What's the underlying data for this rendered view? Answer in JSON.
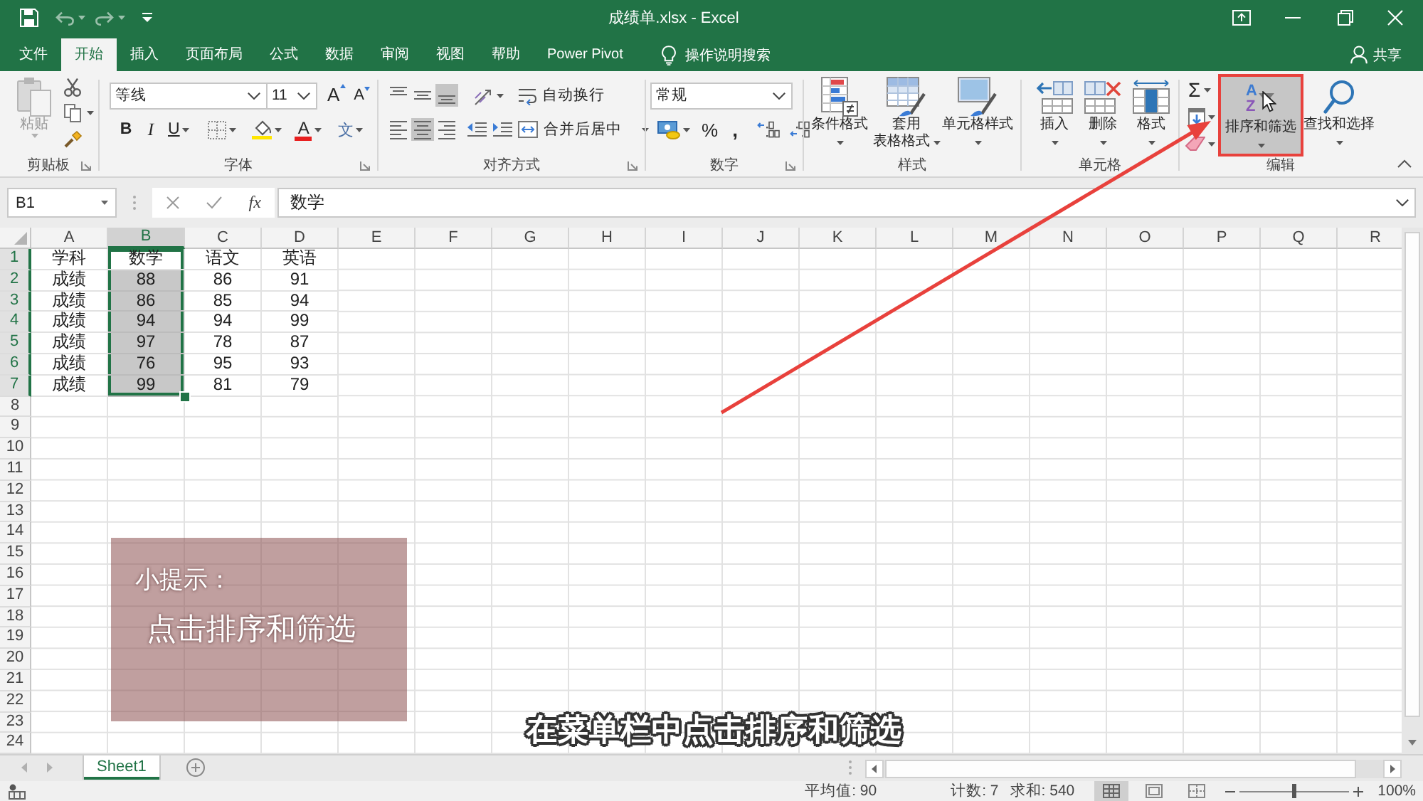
{
  "title_bar": {
    "title": "成绩单.xlsx - Excel"
  },
  "menu_tabs": [
    {
      "label": "文件",
      "selected": false
    },
    {
      "label": "开始",
      "selected": true
    },
    {
      "label": "插入",
      "selected": false
    },
    {
      "label": "页面布局",
      "selected": false
    },
    {
      "label": "公式",
      "selected": false
    },
    {
      "label": "数据",
      "selected": false
    },
    {
      "label": "审阅",
      "selected": false
    },
    {
      "label": "视图",
      "selected": false
    },
    {
      "label": "帮助",
      "selected": false
    },
    {
      "label": "Power Pivot",
      "selected": false
    }
  ],
  "tell_me": {
    "label": "操作说明搜索"
  },
  "share": {
    "label": "共享"
  },
  "ribbon": {
    "groups": [
      {
        "kind": "clipboard",
        "label": "剪贴板",
        "launcher": true,
        "paste": {
          "label": "粘贴",
          "disabled": true
        }
      },
      {
        "kind": "font",
        "label": "字体",
        "launcher": true,
        "font_name": "等线",
        "font_size": "11",
        "grow": "A",
        "shrink": "A",
        "bold": "B",
        "italic": "I",
        "underline": "U",
        "font_color": "A",
        "phonetic": "文"
      },
      {
        "kind": "alignment",
        "label": "对齐方式",
        "launcher": true,
        "vertical": [
          {
            "kind": "top",
            "selected": false
          },
          {
            "kind": "middle",
            "selected": false
          },
          {
            "kind": "bottom",
            "selected": true
          }
        ],
        "horizontal": [
          {
            "kind": "left",
            "selected": false
          },
          {
            "kind": "center",
            "selected": true
          },
          {
            "kind": "right",
            "selected": false
          }
        ],
        "wrap": "自动换行",
        "merge": "合并后居中"
      },
      {
        "kind": "number",
        "label": "数字",
        "launcher": true,
        "format": "常规",
        "percent": "%",
        "comma": ","
      },
      {
        "kind": "styles",
        "label": "样式",
        "launcher": false,
        "buttons": [
          {
            "kind": "conditional",
            "lines": [
              "条件格式"
            ]
          },
          {
            "kind": "table",
            "lines": [
              "套用",
              "表格格式"
            ]
          },
          {
            "kind": "cell_style",
            "lines": [
              "单元格样式"
            ]
          }
        ]
      },
      {
        "kind": "cells",
        "label": "单元格",
        "launcher": false,
        "buttons": [
          {
            "kind": "insert",
            "label": "插入"
          },
          {
            "kind": "delete",
            "label": "删除"
          },
          {
            "kind": "format",
            "label": "格式"
          }
        ]
      },
      {
        "kind": "editing",
        "label": "编辑",
        "launcher": false,
        "autosum": "Σ",
        "buttons": [
          {
            "kind": "sort",
            "label": "排序和筛选",
            "hover": true,
            "framed": true,
            "icon_letters": [
              "A",
              "Z"
            ]
          },
          {
            "kind": "find",
            "label": "查找和选择",
            "hover": false,
            "framed": false
          }
        ]
      }
    ]
  },
  "formula_bar": {
    "name_box": "B1",
    "function_button": "fx",
    "formula": "数学"
  },
  "sheet": {
    "columns": [
      {
        "label": "A",
        "selected": false
      },
      {
        "label": "B",
        "selected": true
      },
      {
        "label": "C",
        "selected": false
      },
      {
        "label": "D",
        "selected": false
      },
      {
        "label": "E",
        "selected": false
      },
      {
        "label": "F",
        "selected": false
      },
      {
        "label": "G",
        "selected": false
      },
      {
        "label": "H",
        "selected": false
      },
      {
        "label": "I",
        "selected": false
      },
      {
        "label": "J",
        "selected": false
      },
      {
        "label": "K",
        "selected": false
      },
      {
        "label": "L",
        "selected": false
      },
      {
        "label": "M",
        "selected": false
      },
      {
        "label": "N",
        "selected": false
      },
      {
        "label": "O",
        "selected": false
      },
      {
        "label": "P",
        "selected": false
      },
      {
        "label": "Q",
        "selected": false
      },
      {
        "label": "R",
        "selected": false
      }
    ],
    "rows": [
      {
        "label": "1",
        "selected": true,
        "cells": [
          {
            "text": "学科",
            "selected": false,
            "active": false
          },
          {
            "text": "数学",
            "selected": true,
            "active": true
          },
          {
            "text": "语文",
            "selected": false,
            "active": false
          },
          {
            "text": "英语",
            "selected": false,
            "active": false
          }
        ]
      },
      {
        "label": "2",
        "selected": true,
        "cells": [
          {
            "text": "成绩",
            "selected": false,
            "active": false
          },
          {
            "text": "88",
            "selected": true,
            "active": false
          },
          {
            "text": "86",
            "selected": false,
            "active": false
          },
          {
            "text": "91",
            "selected": false,
            "active": false
          }
        ]
      },
      {
        "label": "3",
        "selected": true,
        "cells": [
          {
            "text": "成绩",
            "selected": false,
            "active": false
          },
          {
            "text": "86",
            "selected": true,
            "active": false
          },
          {
            "text": "85",
            "selected": false,
            "active": false
          },
          {
            "text": "94",
            "selected": false,
            "active": false
          }
        ]
      },
      {
        "label": "4",
        "selected": true,
        "cells": [
          {
            "text": "成绩",
            "selected": false,
            "active": false
          },
          {
            "text": "94",
            "selected": true,
            "active": false
          },
          {
            "text": "94",
            "selected": false,
            "active": false
          },
          {
            "text": "99",
            "selected": false,
            "active": false
          }
        ]
      },
      {
        "label": "5",
        "selected": true,
        "cells": [
          {
            "text": "成绩",
            "selected": false,
            "active": false
          },
          {
            "text": "97",
            "selected": true,
            "active": false
          },
          {
            "text": "78",
            "selected": false,
            "active": false
          },
          {
            "text": "87",
            "selected": false,
            "active": false
          }
        ]
      },
      {
        "label": "6",
        "selected": true,
        "cells": [
          {
            "text": "成绩",
            "selected": false,
            "active": false
          },
          {
            "text": "76",
            "selected": true,
            "active": false
          },
          {
            "text": "95",
            "selected": false,
            "active": false
          },
          {
            "text": "93",
            "selected": false,
            "active": false
          }
        ]
      },
      {
        "label": "7",
        "selected": true,
        "cells": [
          {
            "text": "成绩",
            "selected": false,
            "active": false
          },
          {
            "text": "99",
            "selected": true,
            "active": false
          },
          {
            "text": "81",
            "selected": false,
            "active": false
          },
          {
            "text": "79",
            "selected": false,
            "active": false
          }
        ]
      },
      {
        "label": "8",
        "selected": false
      },
      {
        "label": "9",
        "selected": false
      },
      {
        "label": "10",
        "selected": false
      },
      {
        "label": "11",
        "selected": false
      },
      {
        "label": "12",
        "selected": false
      },
      {
        "label": "13",
        "selected": false
      },
      {
        "label": "14",
        "selected": false
      },
      {
        "label": "15",
        "selected": false
      },
      {
        "label": "16",
        "selected": false
      },
      {
        "label": "17",
        "selected": false
      },
      {
        "label": "18",
        "selected": false
      },
      {
        "label": "19",
        "selected": false
      },
      {
        "label": "20",
        "selected": false
      },
      {
        "label": "21",
        "selected": false
      },
      {
        "label": "22",
        "selected": false
      },
      {
        "label": "23",
        "selected": false
      },
      {
        "label": "24",
        "selected": false
      }
    ]
  },
  "sheet_tabs": [
    {
      "label": "Sheet1",
      "selected": true
    }
  ],
  "status_bar": {
    "average": "平均值: 90",
    "count": "计数: 7",
    "sum": "求和: 540",
    "views": [
      {
        "kind": "normal",
        "selected": true
      },
      {
        "kind": "page_layout",
        "selected": false
      },
      {
        "kind": "page_break",
        "selected": false
      }
    ],
    "zoom": {
      "level": 0.5,
      "label": "100%"
    }
  },
  "tip_box": {
    "title": "小提示：",
    "body": "点击排序和筛选"
  },
  "subtitle": "在菜单栏中点击排序和筛选"
}
